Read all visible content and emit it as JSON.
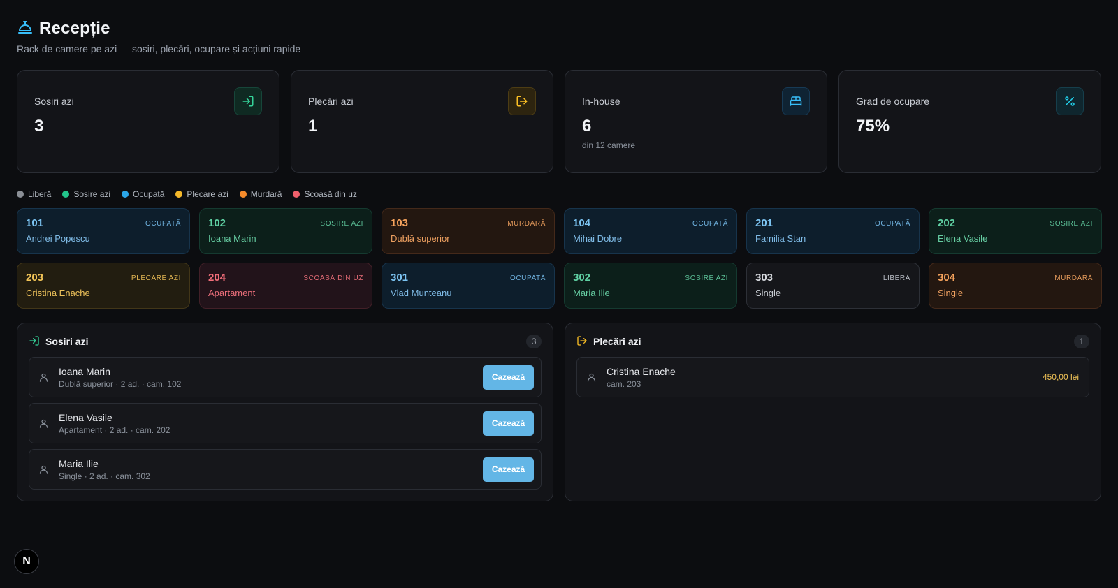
{
  "header": {
    "title": "Recepție",
    "subtitle": "Rack de camere pe azi — sosiri, plecări, ocupare și acțiuni rapide"
  },
  "stats": [
    {
      "label": "Sosiri azi",
      "value": "3",
      "sub": "",
      "icon": "log-in-icon"
    },
    {
      "label": "Plecări azi",
      "value": "1",
      "sub": "",
      "icon": "log-out-icon"
    },
    {
      "label": "In-house",
      "value": "6",
      "sub": "din 12 camere",
      "icon": "bed-icon"
    },
    {
      "label": "Grad de ocupare",
      "value": "75%",
      "sub": "",
      "icon": "percent-icon"
    }
  ],
  "legend": [
    {
      "label": "Liberă",
      "color": "#8b8f96"
    },
    {
      "label": "Sosire azi",
      "color": "#22c58b"
    },
    {
      "label": "Ocupată",
      "color": "#2ba6e8"
    },
    {
      "label": "Plecare azi",
      "color": "#f5b82a"
    },
    {
      "label": "Murdară",
      "color": "#f58a2a"
    },
    {
      "label": "Scoasă din uz",
      "color": "#f0606c"
    }
  ],
  "rooms": [
    {
      "number": "101",
      "status": "OCUPATĂ",
      "guest": "Andrei Popescu"
    },
    {
      "number": "102",
      "status": "SOSIRE AZI",
      "guest": "Ioana Marin"
    },
    {
      "number": "103",
      "status": "MURDARĂ",
      "guest": "Dublă superior"
    },
    {
      "number": "104",
      "status": "OCUPATĂ",
      "guest": "Mihai Dobre"
    },
    {
      "number": "201",
      "status": "OCUPATĂ",
      "guest": "Familia Stan"
    },
    {
      "number": "202",
      "status": "SOSIRE AZI",
      "guest": "Elena Vasile"
    },
    {
      "number": "203",
      "status": "PLECARE AZI",
      "guest": "Cristina Enache"
    },
    {
      "number": "204",
      "status": "SCOASĂ DIN UZ",
      "guest": "Apartament"
    },
    {
      "number": "301",
      "status": "OCUPATĂ",
      "guest": "Vlad Munteanu"
    },
    {
      "number": "302",
      "status": "SOSIRE AZI",
      "guest": "Maria Ilie"
    },
    {
      "number": "303",
      "status": "LIBERĂ",
      "guest": "Single"
    },
    {
      "number": "304",
      "status": "MURDARĂ",
      "guest": "Single"
    }
  ],
  "arrivals": {
    "title": "Sosiri azi",
    "count": "3",
    "items": [
      {
        "name": "Ioana Marin",
        "meta": "Dublă superior · 2 ad. · cam. 102",
        "button": "Cazează"
      },
      {
        "name": "Elena Vasile",
        "meta": "Apartament · 2 ad. · cam. 202",
        "button": "Cazează"
      },
      {
        "name": "Maria Ilie",
        "meta": "Single · 2 ad. · cam. 302",
        "button": "Cazează"
      }
    ]
  },
  "departures": {
    "title": "Plecări azi",
    "count": "1",
    "items": [
      {
        "name": "Cristina Enache",
        "meta": "cam. 203",
        "amount": "450,00 lei"
      }
    ]
  },
  "badge": {
    "label": "N"
  }
}
